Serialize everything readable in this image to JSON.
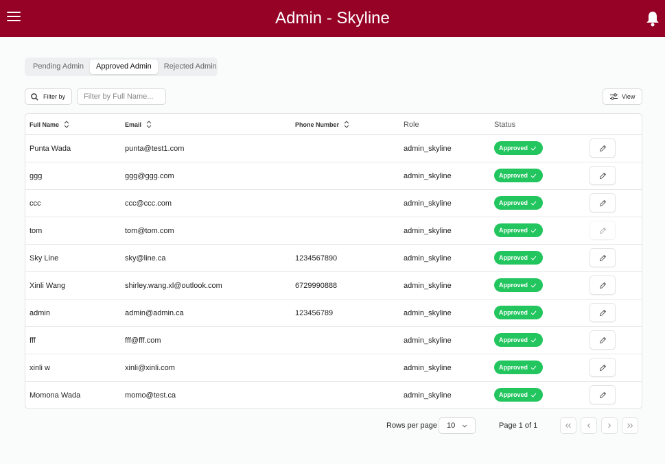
{
  "header": {
    "title": "Admin - Skyline",
    "menu_icon": "hamburger-menu-icon",
    "notification_icon": "bell-icon",
    "brand_color": "#960226"
  },
  "tabs": [
    {
      "label": "Pending Admin",
      "active": false
    },
    {
      "label": "Approved Admin",
      "active": true
    },
    {
      "label": "Rejected Admin",
      "active": false
    }
  ],
  "toolbar": {
    "filter_label": "Filter by",
    "filter_placeholder": "Filter by Full Name...",
    "view_label": "View"
  },
  "table": {
    "columns": [
      "Full Name",
      "Email",
      "Phone Number",
      "Role",
      "Status"
    ],
    "rows": [
      {
        "name": "Punta Wada",
        "email": "punta@test1.com",
        "phone": "",
        "role": "admin_skyline",
        "status": "Approved",
        "edit_disabled": false
      },
      {
        "name": "ggg",
        "email": "ggg@ggg.com",
        "phone": "",
        "role": "admin_skyline",
        "status": "Approved",
        "edit_disabled": false
      },
      {
        "name": "ccc",
        "email": "ccc@ccc.com",
        "phone": "",
        "role": "admin_skyline",
        "status": "Approved",
        "edit_disabled": false
      },
      {
        "name": "tom",
        "email": "tom@tom.com",
        "phone": "",
        "role": "admin_skyline",
        "status": "Approved",
        "edit_disabled": true
      },
      {
        "name": "Sky Line",
        "email": "sky@line.ca",
        "phone": "1234567890",
        "role": "admin_skyline",
        "status": "Approved",
        "edit_disabled": false
      },
      {
        "name": "Xinli Wang",
        "email": "shirley.wang.xl@outlook.com",
        "phone": "6729990888",
        "role": "admin_skyline",
        "status": "Approved",
        "edit_disabled": false
      },
      {
        "name": "admin",
        "email": "admin@admin.ca",
        "phone": "123456789",
        "role": "admin_skyline",
        "status": "Approved",
        "edit_disabled": false
      },
      {
        "name": "fff",
        "email": "fff@fff.com",
        "phone": "",
        "role": "admin_skyline",
        "status": "Approved",
        "edit_disabled": false
      },
      {
        "name": "xinli w",
        "email": "xinli@xinli.com",
        "phone": "",
        "role": "admin_skyline",
        "status": "Approved",
        "edit_disabled": false
      },
      {
        "name": "Momona Wada",
        "email": "momo@test.ca",
        "phone": "",
        "role": "admin_skyline",
        "status": "Approved",
        "edit_disabled": false
      }
    ],
    "status_color": "#22c55e"
  },
  "pagination": {
    "rows_per_page_label": "Rows per page",
    "rows_per_page_value": "10",
    "page_label": "Page 1 of 1"
  }
}
